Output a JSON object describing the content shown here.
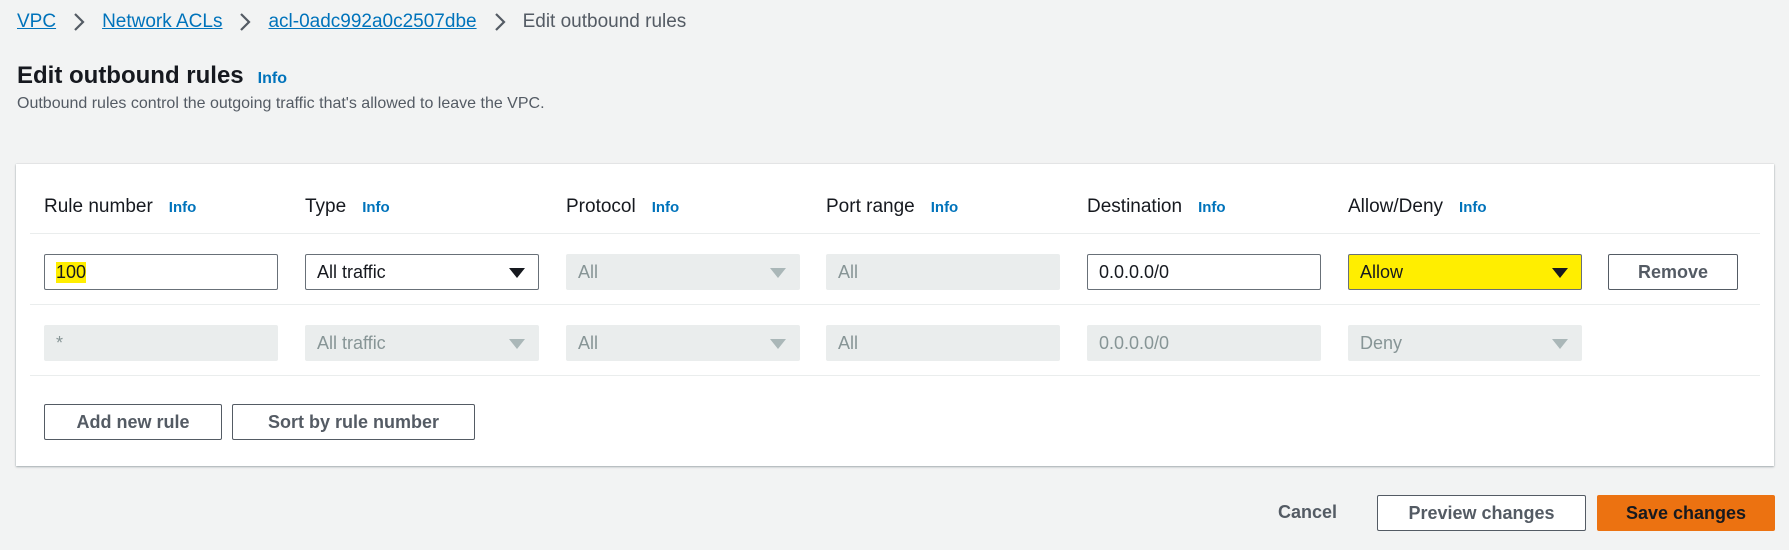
{
  "breadcrumb": {
    "items": [
      "VPC",
      "Network ACLs",
      "acl-0adc992a0c2507dbe"
    ],
    "current": "Edit outbound rules"
  },
  "page": {
    "title": "Edit outbound rules",
    "info": "Info",
    "description": "Outbound rules control the outgoing traffic that's allowed to leave the VPC."
  },
  "table": {
    "columns": [
      {
        "label": "Rule number",
        "info": "Info"
      },
      {
        "label": "Type",
        "info": "Info"
      },
      {
        "label": "Protocol",
        "info": "Info"
      },
      {
        "label": "Port range",
        "info": "Info"
      },
      {
        "label": "Destination",
        "info": "Info"
      },
      {
        "label": "Allow/Deny",
        "info": "Info"
      }
    ],
    "rows": [
      {
        "rule_number": "100",
        "type": "All traffic",
        "protocol": "All",
        "port_range": "All",
        "destination": "0.0.0.0/0",
        "action": "Allow",
        "remove_label": "Remove"
      },
      {
        "rule_number": "*",
        "type": "All traffic",
        "protocol": "All",
        "port_range": "All",
        "destination": "0.0.0.0/0",
        "action": "Deny"
      }
    ],
    "add_rule_label": "Add new rule",
    "sort_label": "Sort by rule number"
  },
  "footer": {
    "cancel_label": "Cancel",
    "preview_label": "Preview changes",
    "save_label": "Save changes"
  },
  "colors": {
    "link": "#0073bb",
    "primary": "#ec7211",
    "highlight": "#ffee00",
    "background": "#f2f3f3"
  }
}
